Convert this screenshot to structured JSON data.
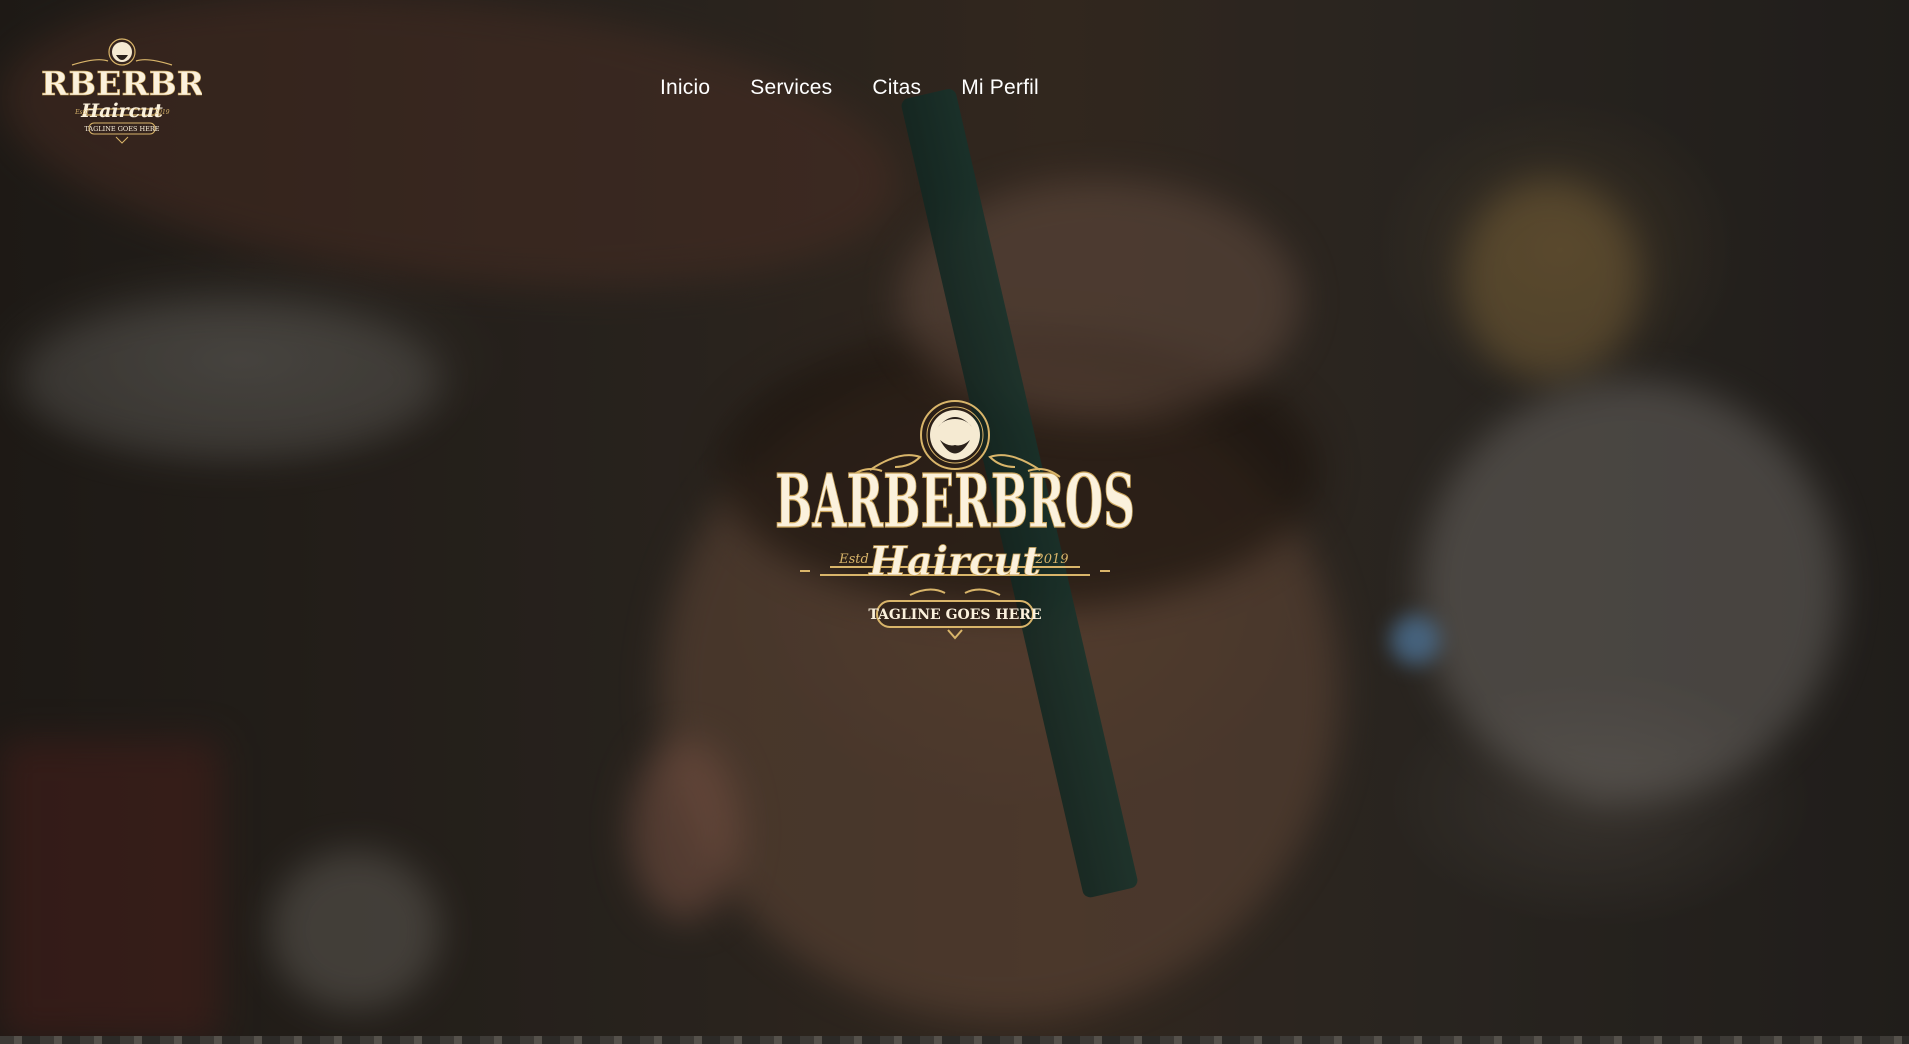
{
  "brand": {
    "name": "BARBERBROS",
    "script": "Haircut",
    "estd": "Estd",
    "year": "2019",
    "tagline": "TAGLINE GOES HERE"
  },
  "nav": {
    "items": [
      {
        "label": "Inicio"
      },
      {
        "label": "Services"
      },
      {
        "label": "Citas"
      },
      {
        "label": "Mi Perfil"
      }
    ]
  },
  "colors": {
    "gold": "#d9b56a",
    "cream": "#fbf1dc",
    "overlay": "#0a0806"
  }
}
